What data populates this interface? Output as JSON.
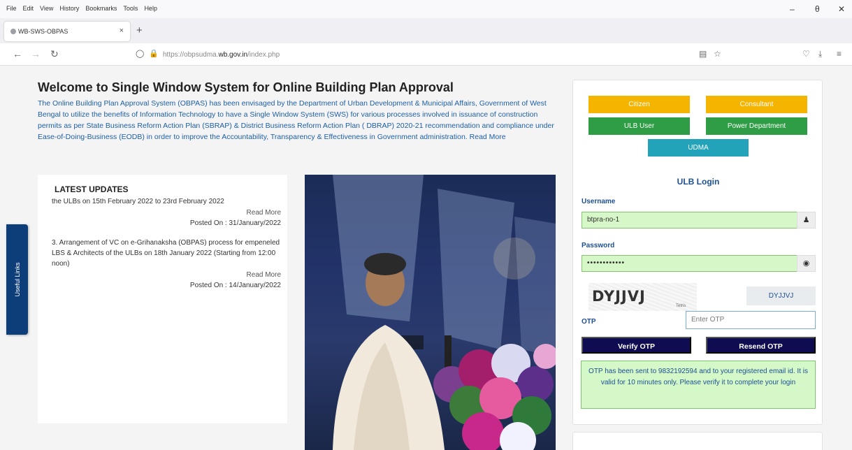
{
  "browser": {
    "menus": [
      "File",
      "Edit",
      "View",
      "History",
      "Bookmarks",
      "Tools",
      "Help"
    ],
    "window_controls": [
      "–",
      "θ",
      "✕"
    ],
    "tab": {
      "title": "WB-SWS-OBPAS",
      "close": "×"
    },
    "new_tab": "+",
    "url": {
      "prefix": "https://obpsudma.",
      "domain": "wb.gov.in",
      "path": "/index.php"
    }
  },
  "welcome": {
    "title": "Welcome to Single Window System for Online Building Plan Approval",
    "body": "The Online Building Plan Approval System (OBPAS) has been envisaged by the Department of Urban Development & Municipal Affairs, Government of West Bengal to utilize the benefits of Information Technology to have a Single Window System (SWS) for various processes involved in issuance of construction permits as per State Business Reform Action Plan (SBRAP) & District Business Reform Action Plan ( DBRAP) 2020-21 recommendation and compliance under Ease-of-Doing-Business (EODB) in order to improve the Accountability, Transparency & Effectiveness in Government administration.",
    "read_more": "Read More"
  },
  "latest_updates": {
    "title": "LATEST UPDATES",
    "items": [
      {
        "text": "the ULBs on 15th February 2022 to 23rd February 2022",
        "read_more": "Read More",
        "posted": "Posted On : 31/January/2022"
      },
      {
        "text": "3. Arrangement of VC on e-Grihanaksha (OBPAS) process for empeneled LBS & Architects of the ULBs on 18th January 2022 (Starting from 12:00 noon)",
        "read_more": "Read More",
        "posted": "Posted On : 14/January/2022"
      }
    ]
  },
  "useful_links": "Useful Links",
  "roles": {
    "citizen": "Citizen",
    "consultant": "Consultant",
    "ulb_user": "ULB User",
    "power_department": "Power Department",
    "udma": "UDMA"
  },
  "login": {
    "title": "ULB Login",
    "username_label": "Username",
    "username_value": "btpra-no-1",
    "password_label": "Password",
    "password_value": "••••••••••••",
    "captcha_text": "DYJJVJ",
    "captcha_tag": "Tetris",
    "captcha_value": "DYJJVJ",
    "otp_label": "OTP",
    "otp_placeholder": "Enter OTP",
    "verify_button": "Verify OTP",
    "resend_button": "Resend OTP",
    "alert": "OTP has been sent to 9832192594 and to your registered email id. It is valid for 10 minutes only. Please verify it to complete your login"
  },
  "colors": {
    "yellow": "#f4b400",
    "green": "#2e9d45",
    "teal": "#22a3b9",
    "navy": "#0f0c52",
    "link_blue": "#1d5fa7"
  }
}
